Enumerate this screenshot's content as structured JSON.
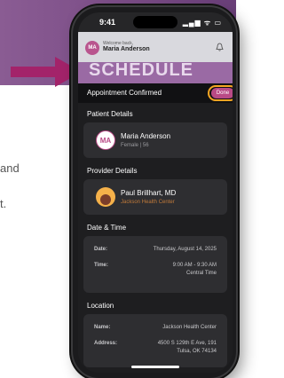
{
  "background": {
    "partial_text_1": "and",
    "partial_text_2": "t."
  },
  "status_bar": {
    "time": "9:41",
    "icons": "▂▄▆ ᯤ ▭"
  },
  "app_header": {
    "avatar_initials": "MA",
    "welcome": "Welcome back,",
    "name": "Maria Anderson",
    "bell_icon": "bell-icon"
  },
  "banner": {
    "text": "SCHEDULE"
  },
  "modal": {
    "title": "Appointment Confirmed",
    "done_label": "Done",
    "patient": {
      "section_label": "Patient Details",
      "initials": "MA",
      "name": "Maria Anderson",
      "detail": "Female | 56"
    },
    "provider": {
      "section_label": "Provider Details",
      "name": "Paul Brillhart, MD",
      "facility": "Jackson Health Center"
    },
    "datetime": {
      "section_label": "Date & Time",
      "date_label": "Date:",
      "date_value": "Thursday, August 14, 2025",
      "time_label": "Time:",
      "time_value_1": "9:00 AM - 9:30 AM",
      "time_value_2": "Central Time"
    },
    "location": {
      "section_label": "Location",
      "name_label": "Name:",
      "name_value": "Jackson Health Center",
      "address_label": "Address:",
      "address_value_1": "4500 S 129th E Ave, 191",
      "address_value_2": "Tulsa, OK 74134"
    }
  },
  "colors": {
    "accent": "#b94a86",
    "highlight": "#f5a623",
    "arrow": "#a3236a",
    "band": "#7a4c86"
  }
}
